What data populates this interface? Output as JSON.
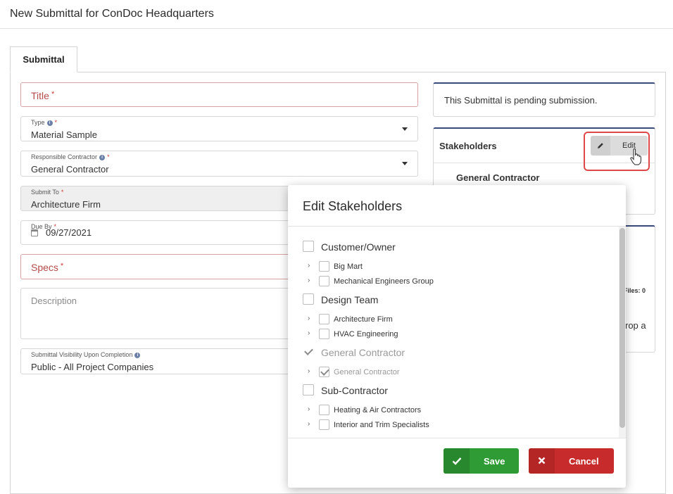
{
  "header": {
    "title": "New Submittal for ConDoc Headquarters"
  },
  "tabs": [
    {
      "label": "Submittal"
    }
  ],
  "form": {
    "title_placeholder": "Title",
    "type": {
      "label": "Type",
      "value": "Material Sample"
    },
    "responsible_contractor": {
      "label": "Responsible Contractor",
      "value": "General Contractor"
    },
    "submit_to": {
      "label": "Submit To",
      "value": "Architecture Firm"
    },
    "due_by": {
      "label": "Due By",
      "value": "09/27/2021"
    },
    "specs_placeholder": "Specs",
    "description_placeholder": "Description",
    "visibility": {
      "label": "Submittal Visibility Upon Completion",
      "value": "Public - All Project Companies"
    },
    "required_mark": "*",
    "info_glyph": "i"
  },
  "status_card": {
    "text": "This Submittal is pending submission."
  },
  "stakeholders_card": {
    "title": "Stakeholders",
    "edit_label": "Edit",
    "edit_icon": "pencil-icon",
    "first_stakeholder": "General Contractor"
  },
  "files_card": {
    "files_text": "Files: 0",
    "drop_text": "rop a"
  },
  "modal": {
    "title": "Edit Stakeholders",
    "groups": [
      {
        "label": "Customer/Owner",
        "checked": false,
        "children": [
          {
            "label": "Big Mart",
            "checked": false
          },
          {
            "label": "Mechanical Engineers Group",
            "checked": false
          }
        ]
      },
      {
        "label": "Design Team",
        "checked": false,
        "children": [
          {
            "label": "Architecture Firm",
            "checked": false
          },
          {
            "label": "HVAC Engineering",
            "checked": false
          }
        ]
      },
      {
        "label": "General Contractor",
        "checked": true,
        "disabled": true,
        "children": [
          {
            "label": "General Contractor",
            "checked": true,
            "disabled": true
          }
        ]
      },
      {
        "label": "Sub-Contractor",
        "checked": false,
        "children": [
          {
            "label": "Heating & Air Contractors",
            "checked": false
          },
          {
            "label": "Interior and Trim Specialists",
            "checked": false
          }
        ]
      }
    ],
    "save_label": "Save",
    "save_icon": "check-icon",
    "cancel_label": "Cancel",
    "cancel_icon": "x-icon",
    "chevron_glyph": "›"
  },
  "colors": {
    "accent_navy": "#3a4a78",
    "save_green": "#2e9b35",
    "cancel_red": "#c72b2b",
    "highlight_red": "#e04848",
    "required_red": "#d03a3a"
  }
}
